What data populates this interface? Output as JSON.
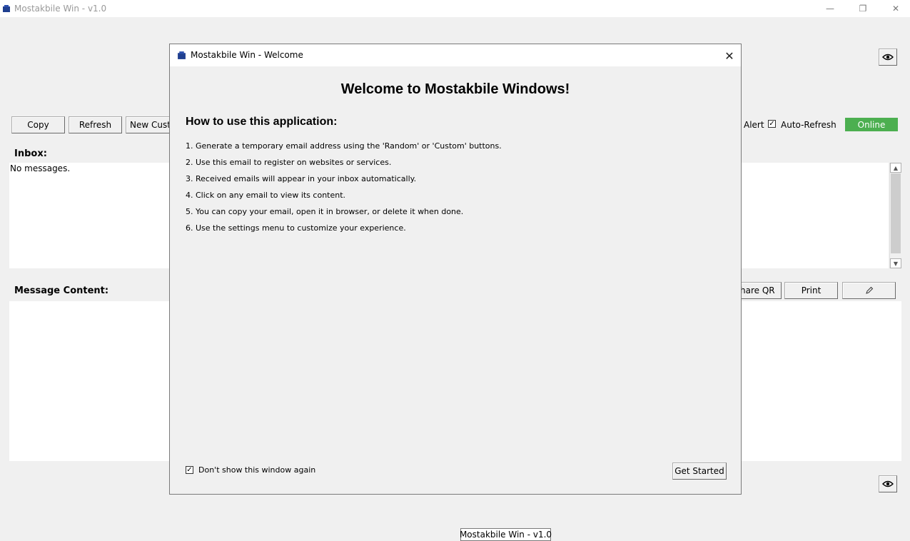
{
  "window": {
    "title": "Mostakbile Win - v1.0",
    "minimize": "—",
    "maximize": "❐",
    "close": "✕"
  },
  "toolbar": {
    "copy": "Copy",
    "refresh": "Refresh",
    "new_custom": "New Custom"
  },
  "options": {
    "alert_label": "Alert",
    "auto_refresh_label": "Auto-Refresh",
    "auto_refresh_checked": true,
    "status": "Online"
  },
  "inbox": {
    "label": "Inbox:",
    "empty_text": "No messages."
  },
  "message": {
    "label": "Message Content:",
    "share_qr": "Share QR",
    "print": "Print"
  },
  "status_chip": "Mostakbile Win - v1.0",
  "dialog": {
    "title": "Mostakbile Win - Welcome",
    "heading": "Welcome to Mostakbile Windows!",
    "subheading": "How to use this application:",
    "steps": [
      "1. Generate a temporary email address using the 'Random' or 'Custom' buttons.",
      "2. Use this email to register on websites or services.",
      "3. Received emails will appear in your inbox automatically.",
      "4. Click on any email to view its content.",
      "5. You can copy your email, open it in browser, or delete it when done.",
      "6. Use the settings menu to customize your experience."
    ],
    "dont_show_label": "Don't show this window again",
    "dont_show_checked": true,
    "get_started": "Get Started"
  },
  "colors": {
    "online_bg": "#4caf50",
    "app_icon": "#1f3f8f"
  },
  "icons": {
    "app": "app-icon",
    "eye": "eye-icon",
    "edit": "pencil-icon"
  }
}
